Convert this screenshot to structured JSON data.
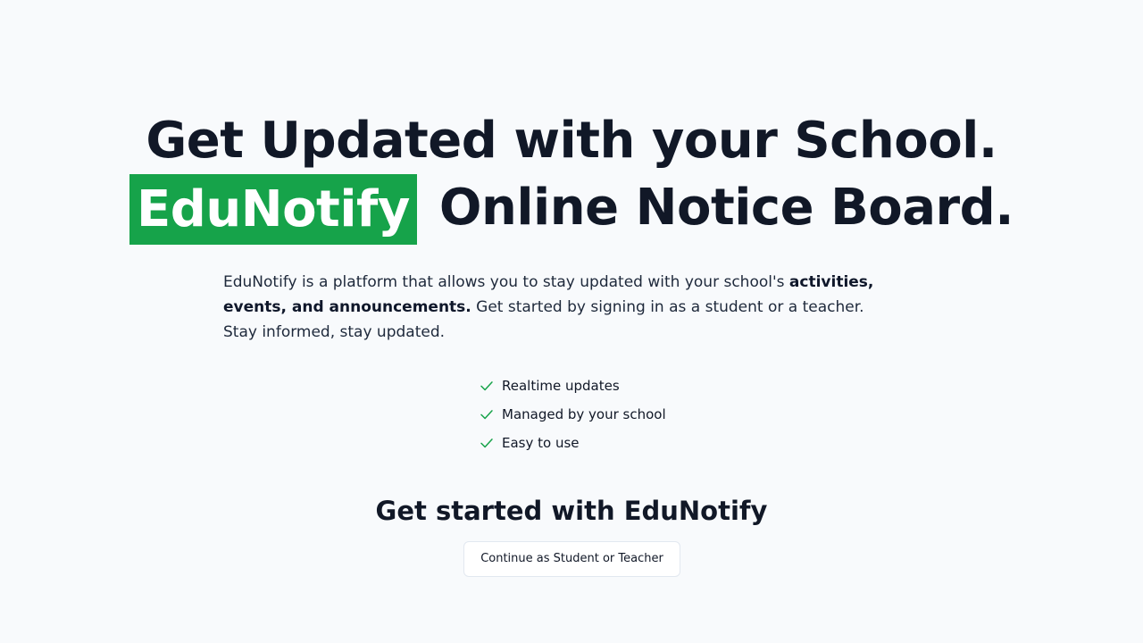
{
  "hero": {
    "title_line_1": "Get Updated with your School.",
    "brand": "EduNotify",
    "title_line_2_rest": "Online Notice Board."
  },
  "description": {
    "intro": "EduNotify is a platform that allows you to stay updated with your school's ",
    "bold": "activities, events, and announcements.",
    "outro": " Get started by signing in as a student or a teacher. Stay informed, stay updated."
  },
  "features": [
    {
      "label": "Realtime updates",
      "icon": "check-icon"
    },
    {
      "label": "Managed by your school",
      "icon": "check-icon"
    },
    {
      "label": "Easy to use",
      "icon": "check-icon"
    }
  ],
  "cta": {
    "heading": "Get started with EduNotify",
    "button_label": "Continue as Student or Teacher"
  },
  "colors": {
    "brand_green": "#16a34a",
    "background": "#f8fafc",
    "text_dark": "#111827"
  }
}
